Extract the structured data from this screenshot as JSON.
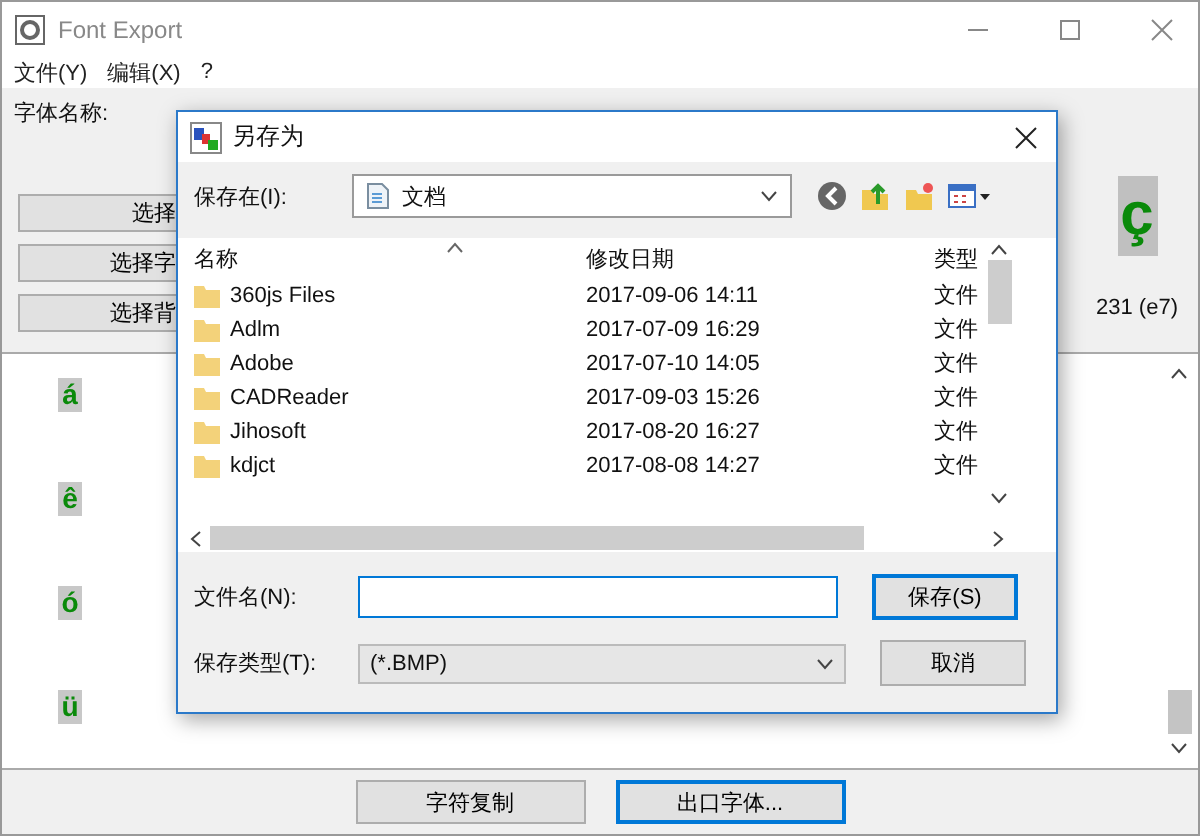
{
  "window": {
    "title": "Font Export"
  },
  "menu": [
    "文件(Y)",
    "编辑(X)",
    "?"
  ],
  "info": {
    "font_name_label": "字体名称:"
  },
  "side_buttons": [
    "选择",
    "选择字",
    "选择背"
  ],
  "preview": {
    "glyph": "ç",
    "code": "231 (e7)"
  },
  "glyphs": [
    "á",
    "ê",
    "ó",
    "ü"
  ],
  "bottom_buttons": [
    {
      "label": "字符复制",
      "default": false
    },
    {
      "label": "出口字体...",
      "default": true
    }
  ],
  "dialog": {
    "title": "另存为",
    "save_in_label": "保存在(I):",
    "location": "文档",
    "columns": [
      "名称",
      "修改日期",
      "类型"
    ],
    "files": [
      {
        "name": "360js Files",
        "modified": "2017-09-06 14:11",
        "type": "文件"
      },
      {
        "name": "Adlm",
        "modified": "2017-07-09 16:29",
        "type": "文件"
      },
      {
        "name": "Adobe",
        "modified": "2017-07-10 14:05",
        "type": "文件"
      },
      {
        "name": "CADReader",
        "modified": "2017-09-03 15:26",
        "type": "文件"
      },
      {
        "name": "Jihosoft",
        "modified": "2017-08-20 16:27",
        "type": "文件"
      },
      {
        "name": "kdjct",
        "modified": "2017-08-08 14:27",
        "type": "文件"
      }
    ],
    "filename_label": "文件名(N):",
    "filetype_label": "保存类型(T):",
    "filetype": "(*.BMP)",
    "buttons": [
      {
        "label": "保存(S)",
        "default": true
      },
      {
        "label": "取消",
        "default": false
      }
    ]
  }
}
